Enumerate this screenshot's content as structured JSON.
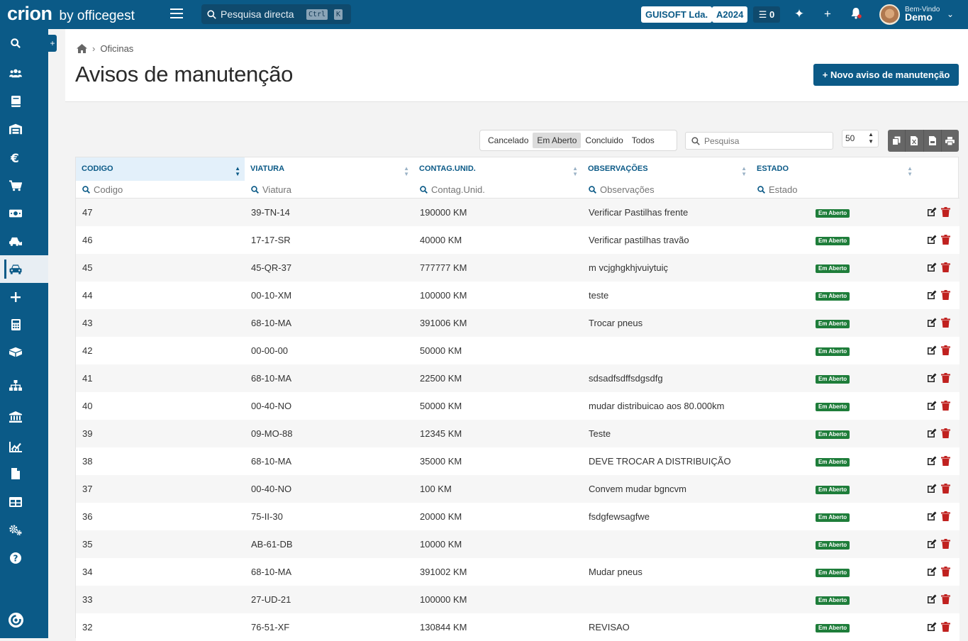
{
  "topbar": {
    "brand": "crion",
    "by": "by officegest",
    "search_label": "Pesquisa directa",
    "shortcut_ctrl": "Ctrl",
    "shortcut_key": "K",
    "company": "GUISOFT Lda.",
    "year": "A2024",
    "tasks_count": "0",
    "welcome": "Bem-Vindo",
    "user": "Demo"
  },
  "sidebar": {
    "items": [
      {
        "icon": "search-icon"
      },
      {
        "icon": "users-icon"
      },
      {
        "icon": "book-icon"
      },
      {
        "icon": "warehouse-icon"
      },
      {
        "icon": "euro-icon"
      },
      {
        "icon": "cart-icon"
      },
      {
        "icon": "money-icon"
      },
      {
        "icon": "car-wash-icon"
      },
      {
        "icon": "car-icon",
        "active": true
      },
      {
        "icon": "plus-icon"
      },
      {
        "icon": "calculator-icon"
      },
      {
        "icon": "boxes-icon"
      },
      {
        "icon": "sitemap-icon"
      },
      {
        "icon": "bank-icon"
      },
      {
        "icon": "chart-icon"
      },
      {
        "icon": "file-icon"
      },
      {
        "icon": "table-icon"
      },
      {
        "icon": "cogs-icon"
      },
      {
        "icon": "help-icon"
      }
    ],
    "bottom_icon": "officegest-logo-icon"
  },
  "breadcrumb": {
    "section": "Oficinas"
  },
  "page": {
    "title": "Avisos de manutenção",
    "new_button": "+ Novo aviso de manutenção"
  },
  "filters": {
    "options": [
      "Cancelado",
      "Em Aberto",
      "Concluido",
      "Todos"
    ],
    "selected": "Em Aberto"
  },
  "search": {
    "placeholder": "Pesquisa"
  },
  "page_size": "50",
  "table": {
    "columns": [
      "CODIGO",
      "VIATURA",
      "CONTAG.UNID.",
      "OBSERVAÇÕES",
      "ESTADO"
    ],
    "filter_placeholders": [
      "Codigo",
      "Viatura",
      "Contag.Unid.",
      "Observações",
      "Estado"
    ],
    "rows": [
      {
        "codigo": "47",
        "viatura": "39-TN-14",
        "contag": "190000 KM",
        "obs": "Verificar Pastilhas frente",
        "estado": "Em Aberto"
      },
      {
        "codigo": "46",
        "viatura": "17-17-SR",
        "contag": "40000 KM",
        "obs": "Verificar pastilhas travão",
        "estado": "Em Aberto"
      },
      {
        "codigo": "45",
        "viatura": "45-QR-37",
        "contag": "777777 KM",
        "obs": "m vcjghgkhjvuiytuiç",
        "estado": "Em Aberto"
      },
      {
        "codigo": "44",
        "viatura": "00-10-XM",
        "contag": "100000 KM",
        "obs": "teste",
        "estado": "Em Aberto"
      },
      {
        "codigo": "43",
        "viatura": "68-10-MA",
        "contag": "391006 KM",
        "obs": "Trocar pneus",
        "estado": "Em Aberto"
      },
      {
        "codigo": "42",
        "viatura": "00-00-00",
        "contag": "50000 KM",
        "obs": "",
        "estado": "Em Aberto"
      },
      {
        "codigo": "41",
        "viatura": "68-10-MA",
        "contag": "22500 KM",
        "obs": "sdsadfsdffsdgsdfg",
        "estado": "Em Aberto"
      },
      {
        "codigo": "40",
        "viatura": "00-40-NO",
        "contag": "50000 KM",
        "obs": "mudar distribuicao aos 80.000km",
        "estado": "Em Aberto"
      },
      {
        "codigo": "39",
        "viatura": "09-MO-88",
        "contag": "12345 KM",
        "obs": "Teste",
        "estado": "Em Aberto"
      },
      {
        "codigo": "38",
        "viatura": "68-10-MA",
        "contag": "35000 KM",
        "obs": "DEVE TROCAR A DISTRIBUIÇÃO",
        "estado": "Em Aberto"
      },
      {
        "codigo": "37",
        "viatura": "00-40-NO",
        "contag": "100 KM",
        "obs": "Convem mudar bgncvm",
        "estado": "Em Aberto"
      },
      {
        "codigo": "36",
        "viatura": "75-II-30",
        "contag": "20000 KM",
        "obs": "fsdgfewsagfwe",
        "estado": "Em Aberto"
      },
      {
        "codigo": "35",
        "viatura": "AB-61-DB",
        "contag": "10000 KM",
        "obs": "",
        "estado": "Em Aberto"
      },
      {
        "codigo": "34",
        "viatura": "68-10-MA",
        "contag": "391002 KM",
        "obs": "Mudar pneus",
        "estado": "Em Aberto"
      },
      {
        "codigo": "33",
        "viatura": "27-UD-21",
        "contag": "100000 KM",
        "obs": "",
        "estado": "Em Aberto"
      },
      {
        "codigo": "32",
        "viatura": "76-51-XF",
        "contag": "130844 KM",
        "obs": "REVISAO",
        "estado": "Em Aberto"
      }
    ]
  },
  "colors": {
    "primary": "#0b5a87",
    "badge_green": "#1e7d3a",
    "delete_red": "#c0211f"
  }
}
